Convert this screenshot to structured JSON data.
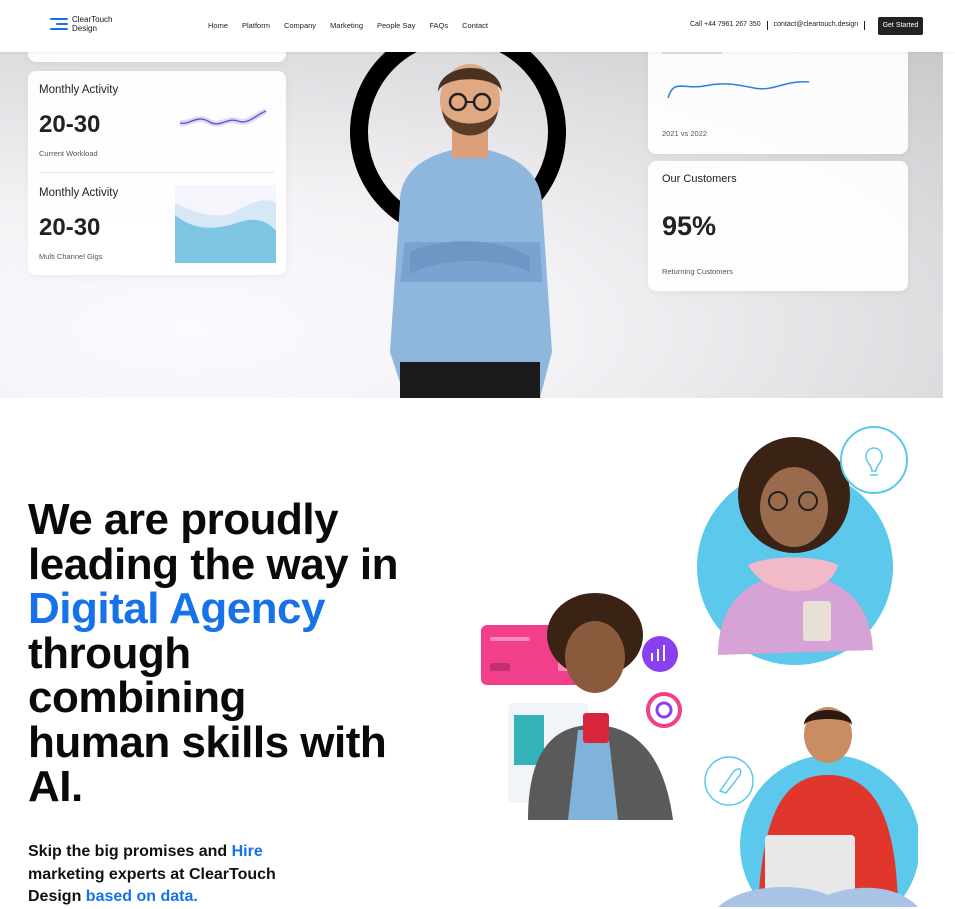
{
  "nav": {
    "logo_line1": "ClearTouch",
    "logo_line2": "Design",
    "menu": [
      "Home",
      "Platform",
      "Company",
      "Marketing",
      "People Say",
      "FAQs",
      "Contact"
    ],
    "phone": "Call +44 7961 267 350",
    "email": "contact@cleartouch.design",
    "cta": "Get Started"
  },
  "hero": {
    "card1": {
      "label": "Monthly Activity",
      "value": "20-30",
      "sub": "Current Workload"
    },
    "card2": {
      "label": "Monthly Activity",
      "value": "20-30",
      "sub": "Multi Channel Gigs"
    },
    "card3": {
      "sub": "2021 vs 2022"
    },
    "card4": {
      "label": "Our Customers",
      "value": "95%",
      "sub": "Returning Customers"
    }
  },
  "section": {
    "headline_1": "We are proudly",
    "headline_2": "leading the way in",
    "headline_blue": "Digital Agency",
    "headline_3": "through",
    "headline_4": "combining",
    "headline_5": "human skills with",
    "headline_6": "AI.",
    "sub_1": "Skip the big promises and ",
    "sub_blue1": "Hire",
    "sub_2": " marketing experts at ClearTouch Design ",
    "sub_blue2": "based on data."
  },
  "colors": {
    "accent": "#1672ea",
    "sky": "#5bc8ec",
    "pink": "#f23f8c",
    "purple": "#8a3ff0"
  },
  "icons": [
    "lightbulb-icon",
    "rocket-icon",
    "chart-up-icon",
    "target-icon"
  ]
}
